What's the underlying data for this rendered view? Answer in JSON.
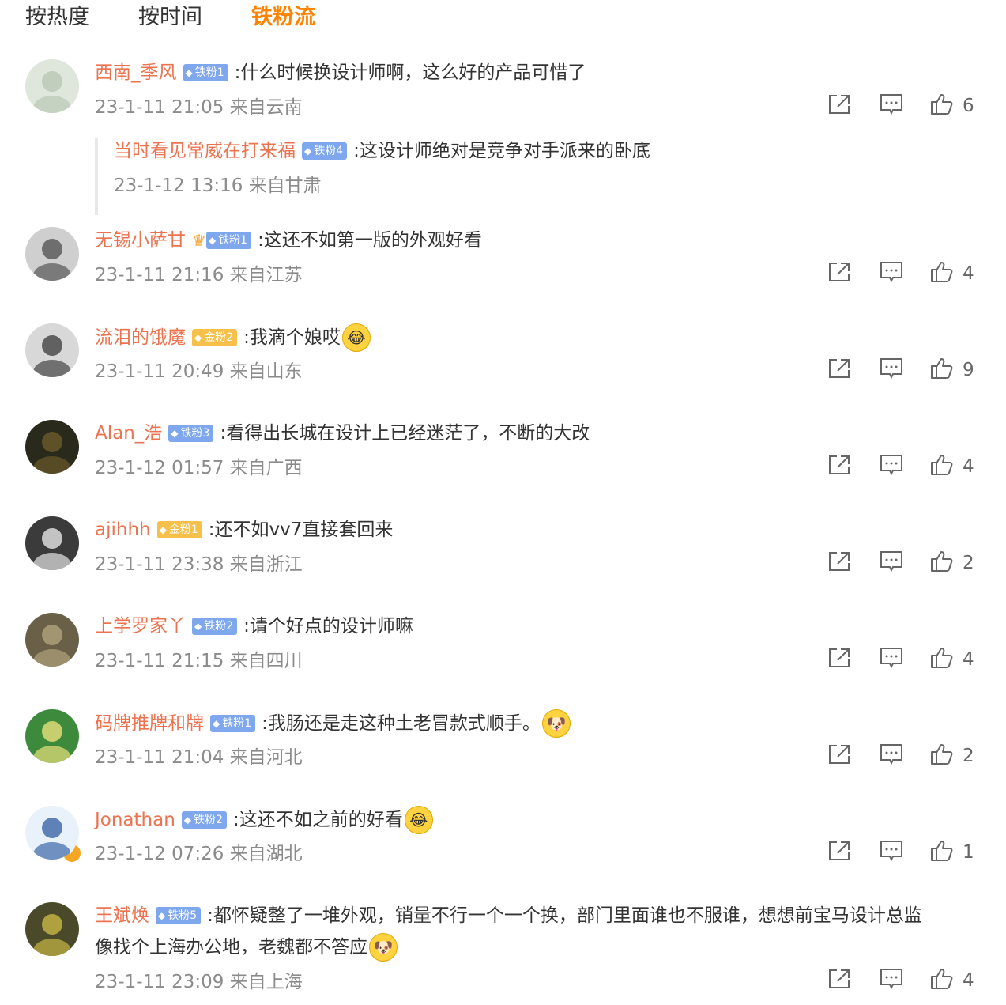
{
  "tabs": [
    "按热度",
    "按时间",
    "铁粉流"
  ],
  "active_tab": 2,
  "comments": [
    {
      "name": "西南_季风",
      "badge": "铁粉1",
      "badge_type": "blue",
      "text": ":什么时候换设计师啊，这么好的产品可惜了",
      "time": "23-1-11 21:05 来自云南",
      "likes": "6",
      "reply": {
        "name": "当时看见常威在打来福",
        "badge": "铁粉4",
        "text": ":这设计师绝对是竞争对手派来的卧底",
        "time": "23-1-12 13:16 来自甘肃"
      }
    },
    {
      "name": "无锡小萨甘",
      "badge": "铁粉1",
      "badge_type": "blue",
      "crown": true,
      "text": ":这还不如第一版的外观好看",
      "time": "23-1-11 21:16 来自江苏",
      "likes": "4"
    },
    {
      "name": "流泪的饿魔",
      "badge": "金粉2",
      "badge_type": "gold",
      "text": ":我滴个娘哎",
      "emoji": "laugh-cry-emoji",
      "time": "23-1-11 20:49 来自山东",
      "likes": "9"
    },
    {
      "name": "Alan_浩",
      "badge": "铁粉3",
      "badge_type": "blue",
      "text": ":看得出长城在设计上已经迷茫了，不断的大改",
      "time": "23-1-12 01:57 来自广西",
      "likes": "4"
    },
    {
      "name": "ajihhh",
      "badge": "金粉1",
      "badge_type": "gold",
      "text": ":还不如vv7直接套回来",
      "time": "23-1-11 23:38 来自浙江",
      "likes": "2"
    },
    {
      "name": "上学罗家丫",
      "badge": "铁粉2",
      "badge_type": "blue",
      "text": ":请个好点的设计师嘛",
      "time": "23-1-11 21:15 来自四川",
      "likes": "4"
    },
    {
      "name": "码牌推牌和牌",
      "badge": "铁粉1",
      "badge_type": "blue",
      "text": ":我肠还是走这种土老冒款式顺手。",
      "emoji": "doge-emoji",
      "time": "23-1-11 21:04 来自河北",
      "likes": "2"
    },
    {
      "name": "Jonathan",
      "badge": "铁粉2",
      "badge_type": "blue",
      "text": ":这还不如之前的好看",
      "emoji": "laugh-cry-emoji",
      "verified": true,
      "time": "23-1-12 07:26 来自湖北",
      "likes": "1"
    },
    {
      "name": "王斌焕",
      "badge": "铁粉5",
      "badge_type": "blue",
      "text": ":都怀疑整了一堆外观，销量不行一个一个换，部门里面谁也不服谁，想想前宝马设计总监",
      "text2": "像找个上海办公地，老魏都不答应",
      "emoji": "doge-emoji",
      "time": "23-1-11 23:09 来自上海",
      "likes": "4"
    }
  ],
  "colors": {
    "accent": "#ff8200",
    "name": "#eb7350",
    "meta": "#8b8b8b",
    "badge_blue": "#7ea7ee",
    "badge_gold": "#f7c04a"
  },
  "icons": {
    "share": "share-icon",
    "comment": "comment-icon",
    "like": "thumbs-up-icon"
  }
}
